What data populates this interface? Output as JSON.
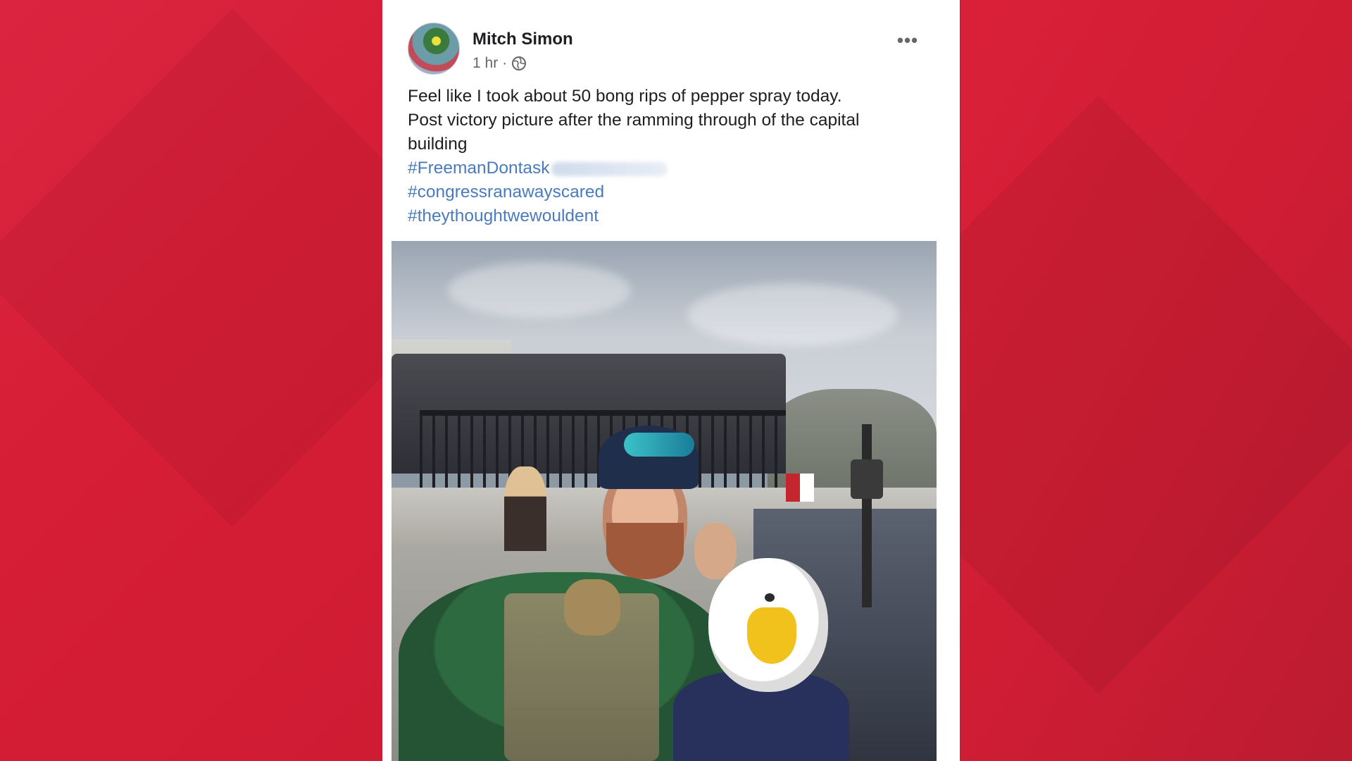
{
  "post": {
    "author": "Mitch Simon",
    "time": "1 hr",
    "separator": "·",
    "privacy_icon": "globe-icon",
    "more_icon": "•••",
    "text_lines": [
      "Feel like I took about 50 bong rips of pepper spray today.",
      "Post victory picture after the ramming through of the capital",
      "building"
    ],
    "hashtags": [
      "#FreemanDontask",
      "#congressranawayscared",
      "#theythoughtwewouldent"
    ],
    "photo_alt": "photo"
  },
  "colors": {
    "background": "#d81e35",
    "card": "#ffffff",
    "hashtag": "#4a7bbd",
    "name": "#1c1e21",
    "meta": "#65676b"
  }
}
